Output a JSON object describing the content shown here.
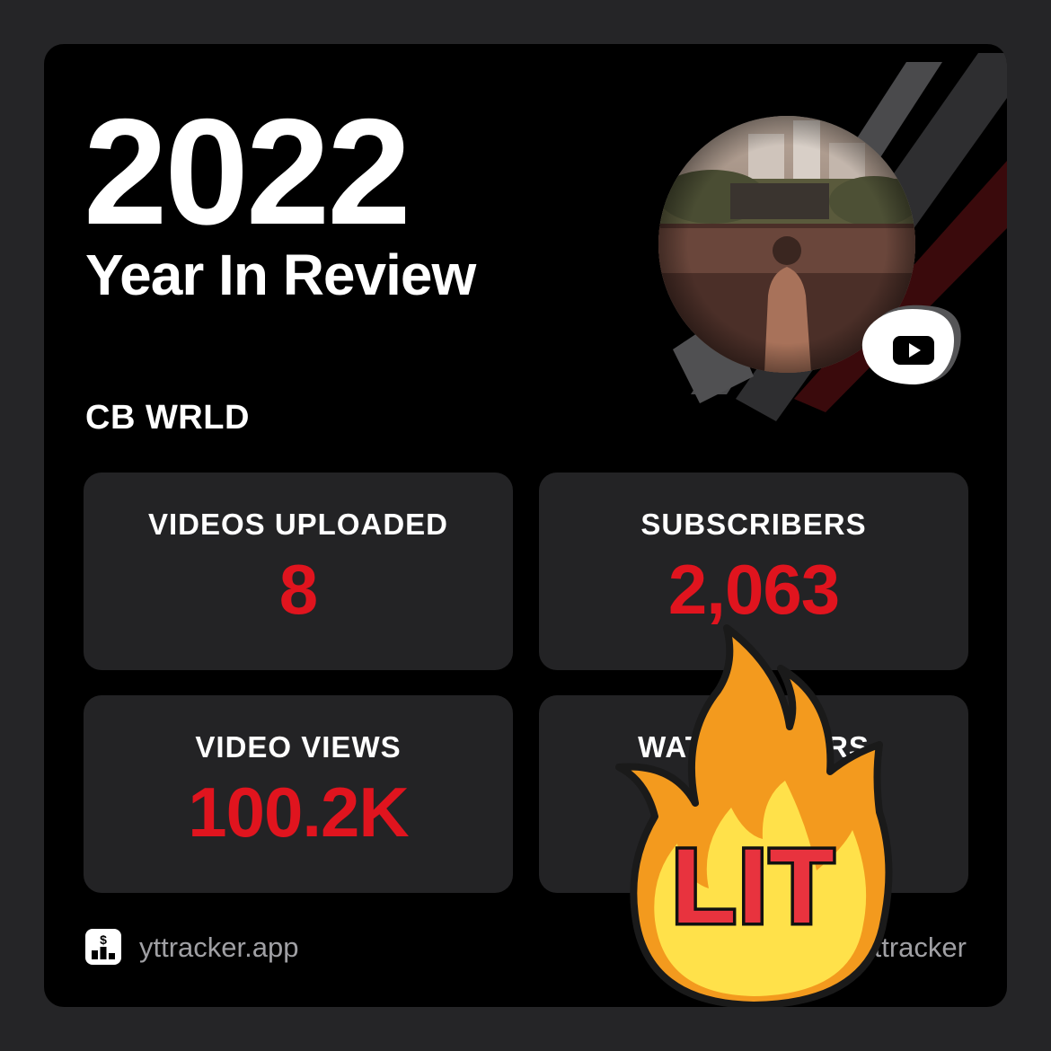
{
  "header": {
    "year": "2022",
    "subtitle": "Year In Review"
  },
  "channel": {
    "name": "CB WRLD",
    "avatar": "concert-crowd-photo",
    "platform_icon": "youtube-play-icon"
  },
  "stats": [
    {
      "label": "VIDEOS UPLOADED",
      "value": "8"
    },
    {
      "label": "SUBSCRIBERS",
      "value": "2,063"
    },
    {
      "label": "VIDEO VIEWS",
      "value": "100.2K"
    },
    {
      "label": "WATCH HOURS",
      "value": ""
    }
  ],
  "footer": {
    "site": "yttracker.app",
    "hashtag": "#yttracker",
    "icon": "chart-dollar-icon"
  },
  "sticker": {
    "text": "LIT",
    "icon": "flame-icon"
  },
  "colors": {
    "background": "#252527",
    "card": "#000000",
    "tile": "#232325",
    "accent": "#e0141e",
    "muted_text": "#a0a0a4"
  }
}
